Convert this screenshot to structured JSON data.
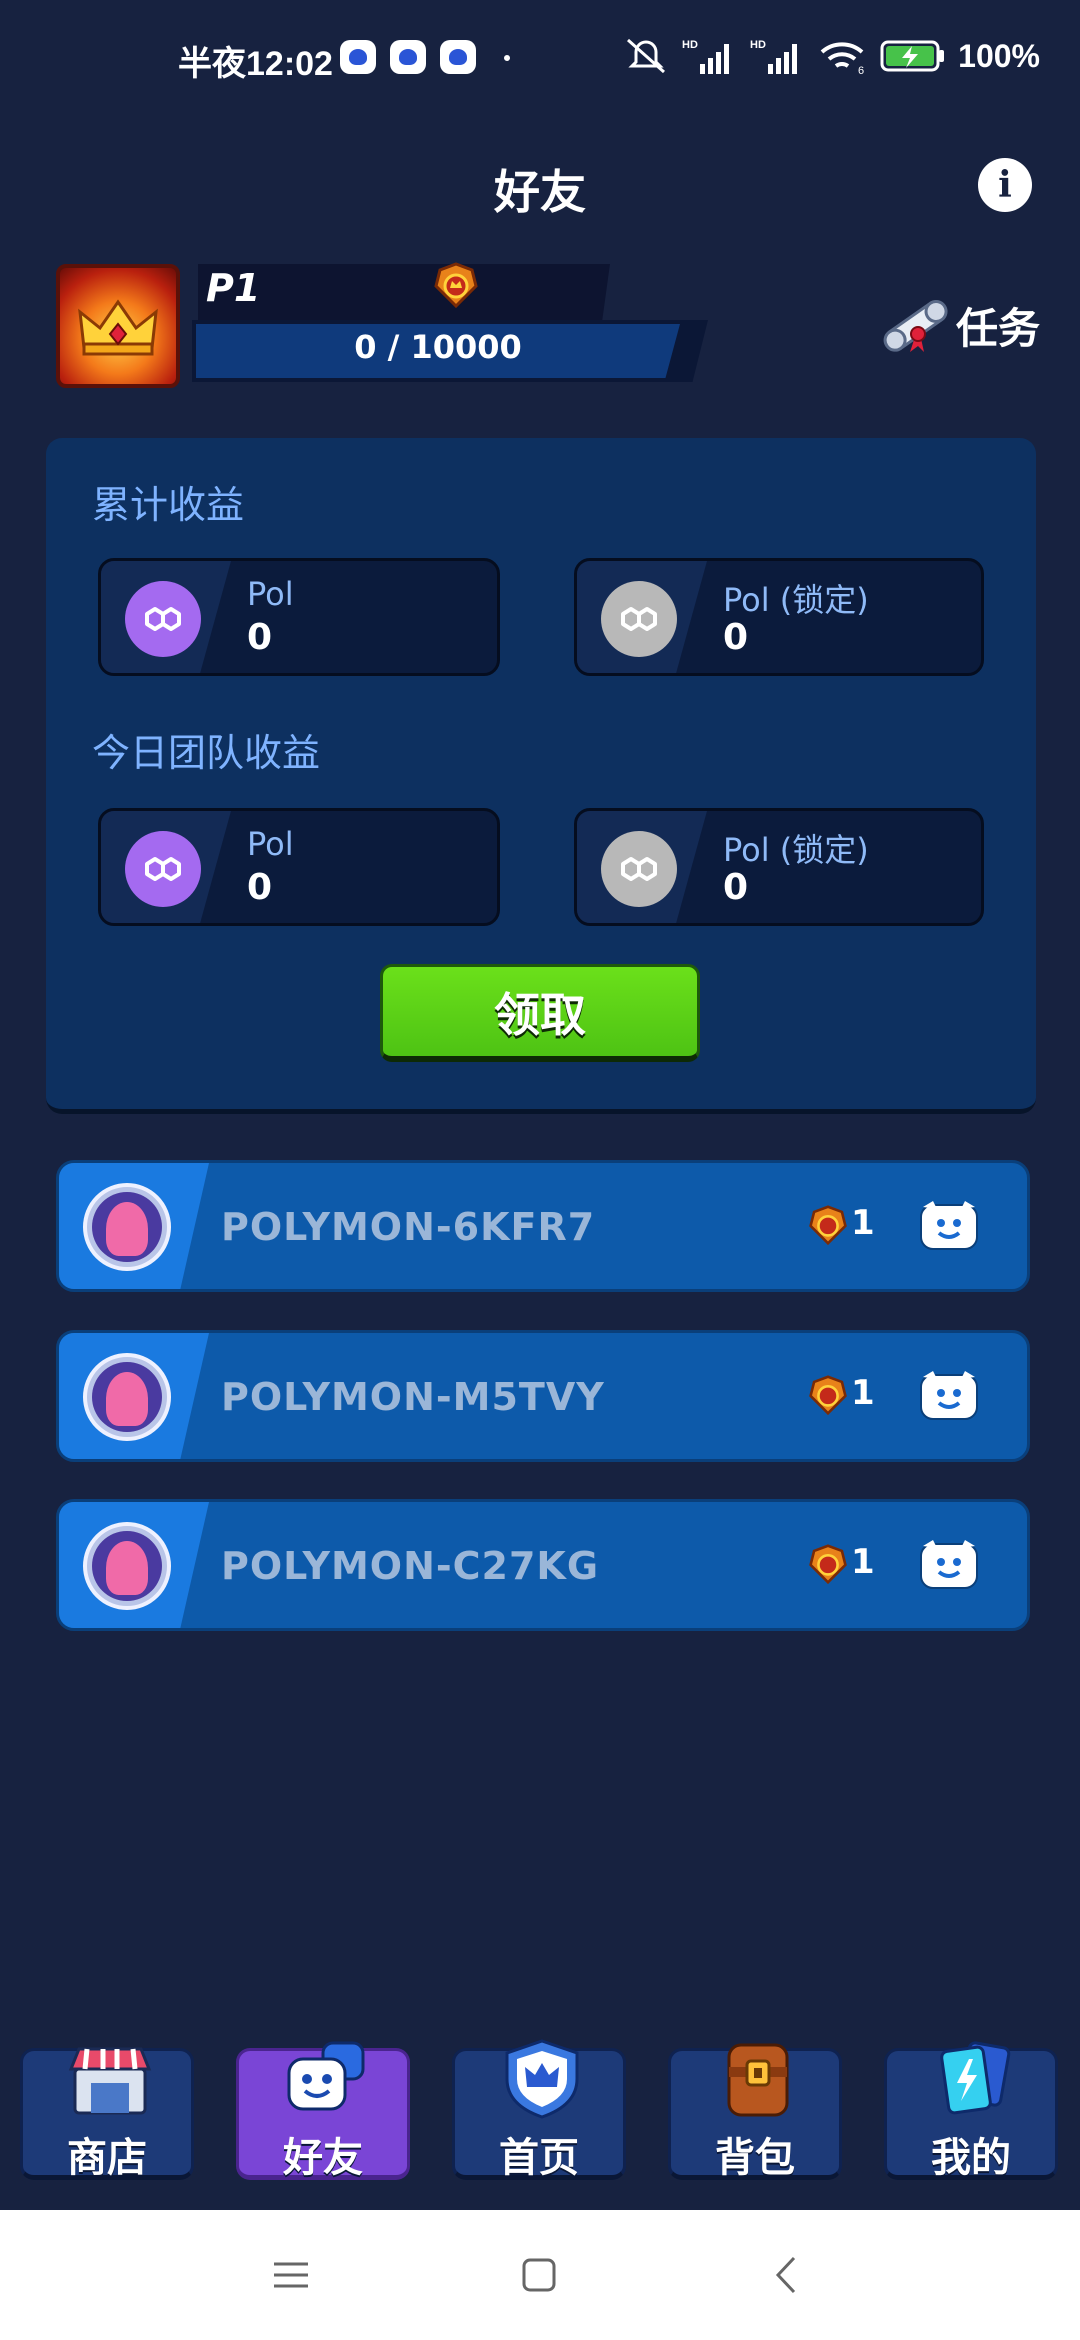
{
  "status_bar": {
    "time": "半夜12:02",
    "battery": "100%",
    "icons": [
      "baidu-paw-icon",
      "baidu-paw-icon",
      "baidu-paw-icon",
      "mute-icon",
      "hd-signal-icon",
      "hd-signal-icon",
      "wifi-icon",
      "battery-charging-icon"
    ]
  },
  "header": {
    "title": "好友",
    "info_label": "i"
  },
  "player": {
    "name": "P1",
    "xp_text": "0 / 10000",
    "xp_progress": 0,
    "task_label": "任务"
  },
  "earnings": {
    "total_label": "累计收益",
    "today_label": "今日团队收益",
    "total": [
      {
        "name": "Pol",
        "value": "0"
      },
      {
        "name": "Pol (锁定)",
        "value": "0"
      }
    ],
    "today": [
      {
        "name": "Pol",
        "value": "0"
      },
      {
        "name": "Pol (锁定)",
        "value": "0"
      }
    ],
    "claim_label": "领取"
  },
  "friends": [
    {
      "name": "POLYMON-6KFR7",
      "level": "1"
    },
    {
      "name": "POLYMON-M5TVY",
      "level": "1"
    },
    {
      "name": "POLYMON-C27KG",
      "level": "1"
    }
  ],
  "bottom_nav": [
    {
      "label": "商店",
      "icon": "shop-icon"
    },
    {
      "label": "好友",
      "icon": "friends-icon",
      "active": true
    },
    {
      "label": "首页",
      "icon": "home-shield-icon"
    },
    {
      "label": "背包",
      "icon": "backpack-icon"
    },
    {
      "label": "我的",
      "icon": "cards-icon"
    }
  ],
  "colors": {
    "background": "#172240",
    "panel": "#0d3060",
    "accent_green": "#5ed016",
    "active_tab": "#7a45d6",
    "pol_purple": "#a46af0"
  }
}
